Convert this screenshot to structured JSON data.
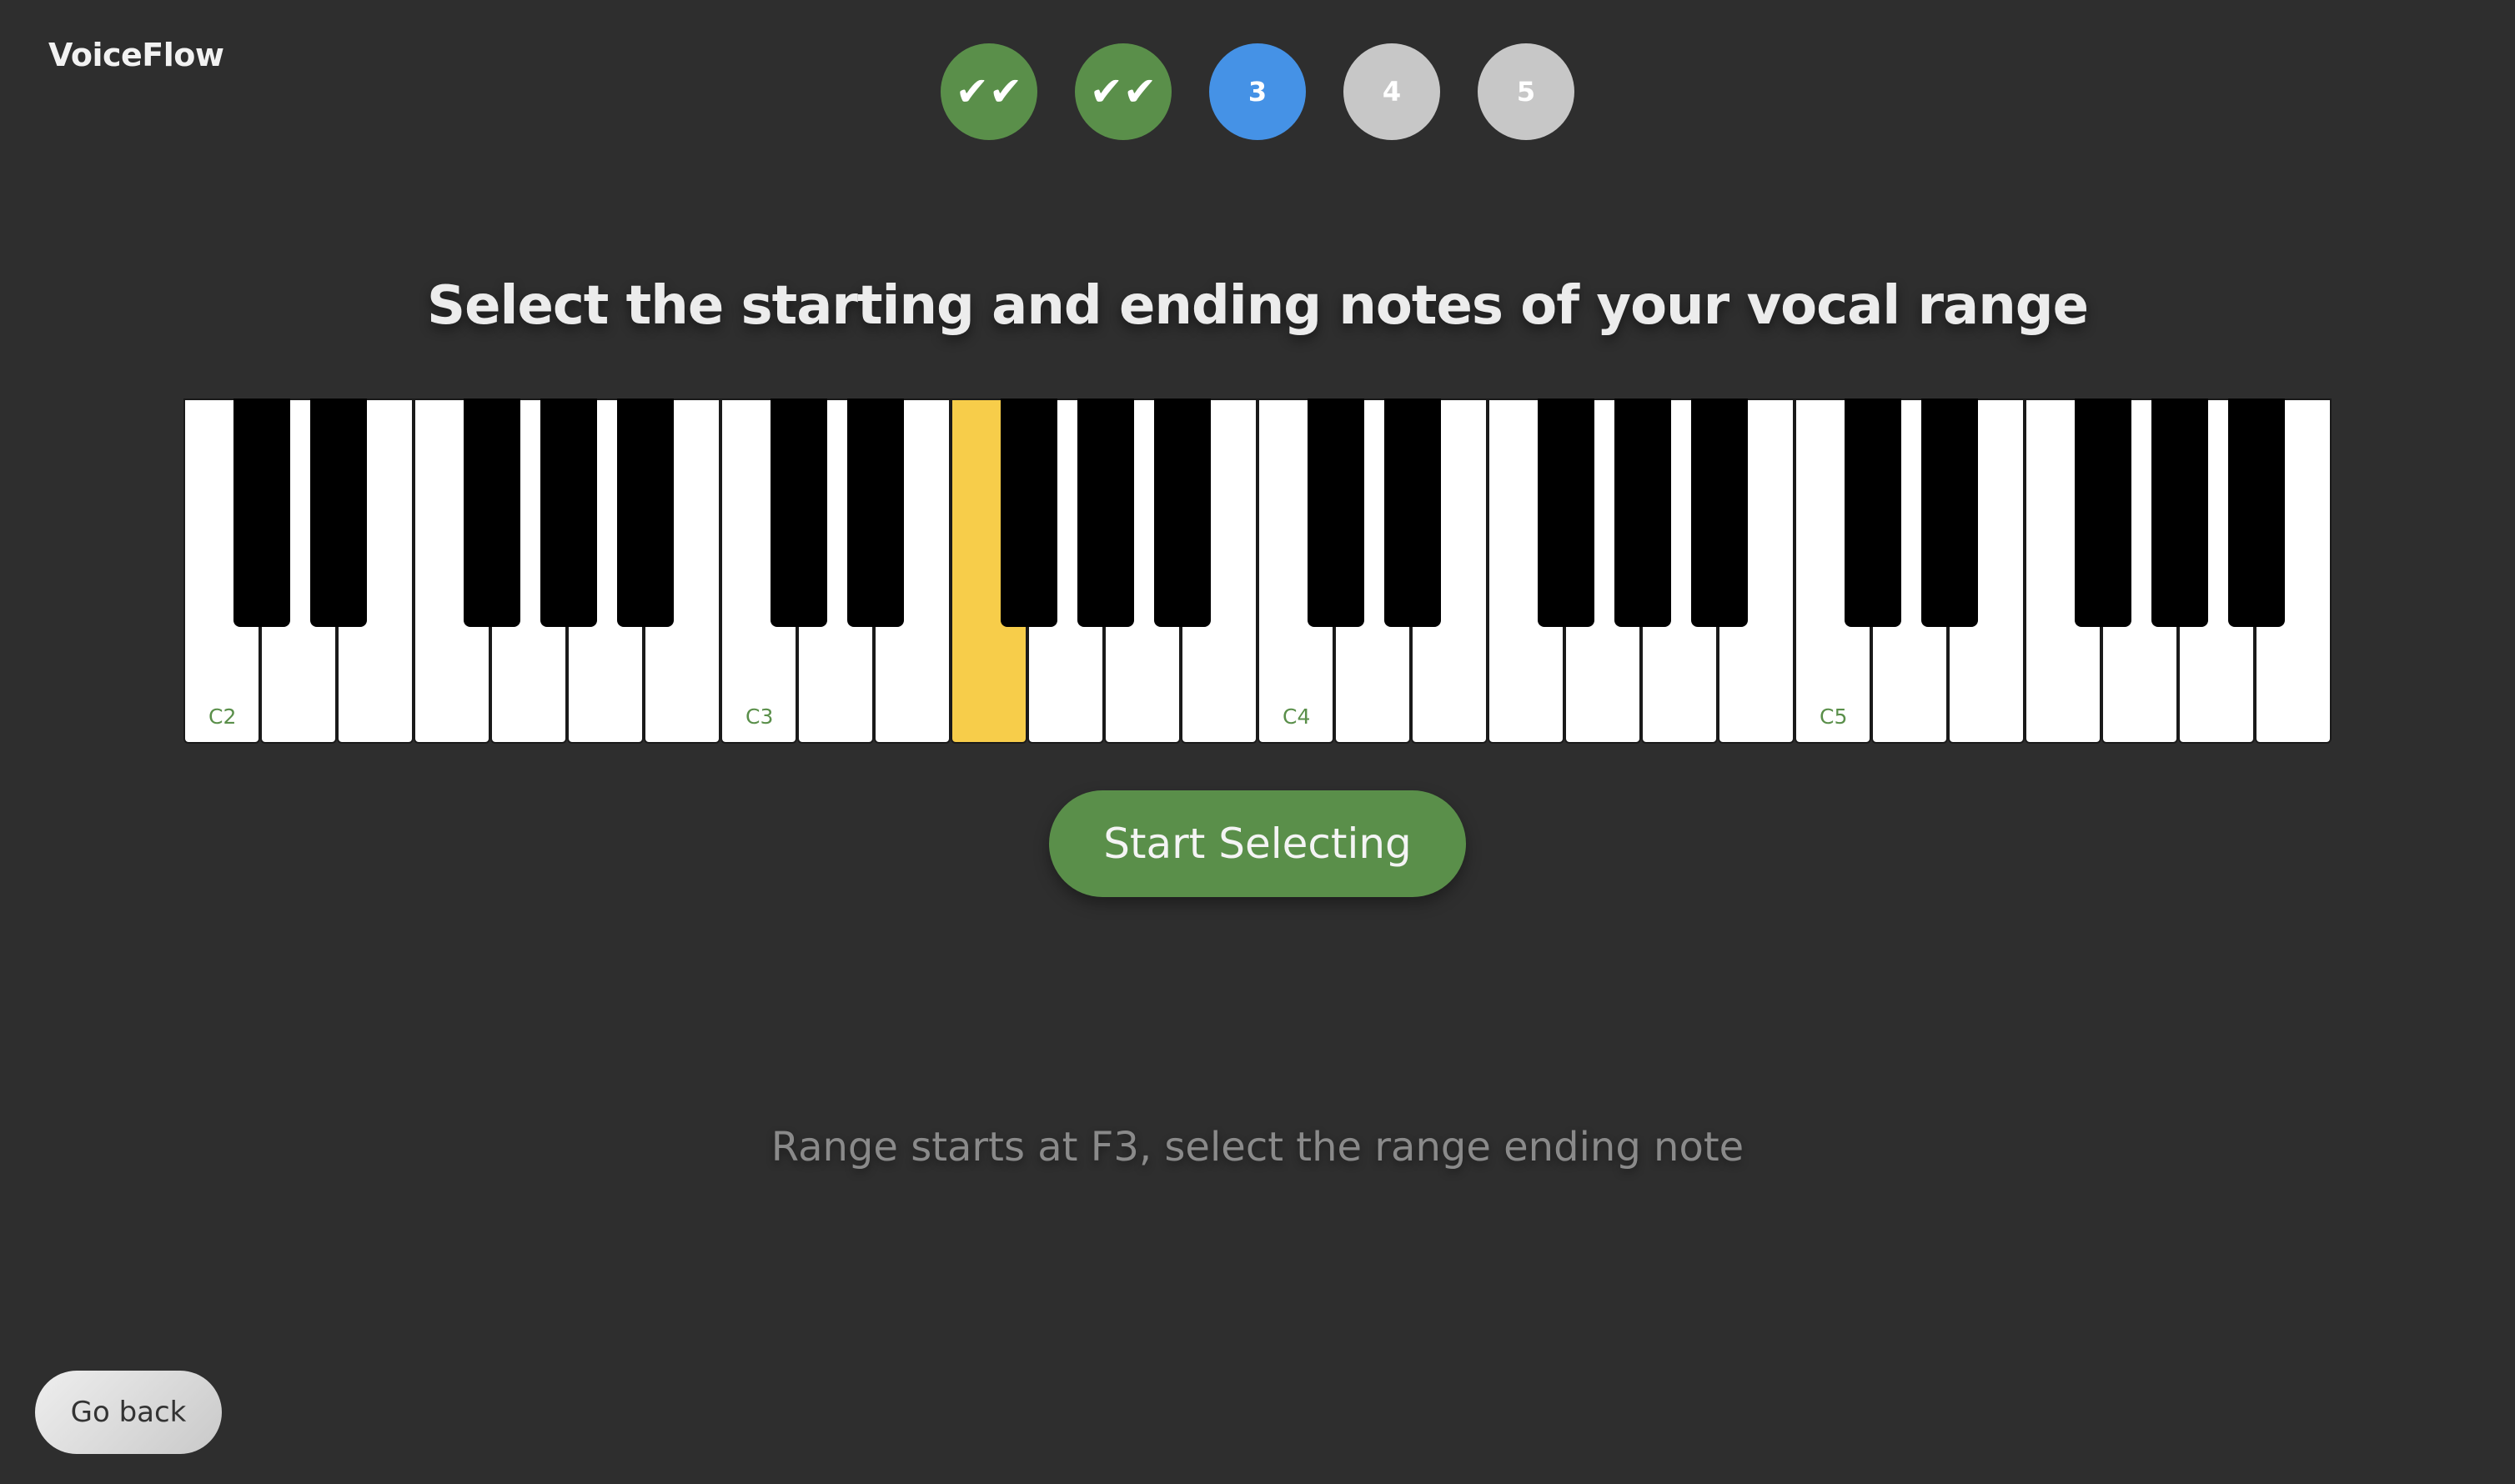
{
  "app": {
    "logo": "VoiceFlow"
  },
  "steps": [
    {
      "label": "✔✔",
      "state": "done"
    },
    {
      "label": "✔✔",
      "state": "done"
    },
    {
      "label": "3",
      "state": "current"
    },
    {
      "label": "4",
      "state": "pending"
    },
    {
      "label": "5",
      "state": "pending"
    }
  ],
  "main": {
    "title": "Select the starting and ending notes of your vocal range",
    "start_button": "Start Selecting",
    "status": "Range starts at F3, select the range ending note",
    "back_button": "Go back"
  },
  "piano": {
    "octave_labels": [
      "C2",
      "C3",
      "C4",
      "C5"
    ],
    "range": "C2–B5",
    "selected_note": "F3"
  },
  "colors": {
    "background": "#2e2e2e",
    "done": "#5a8f4a",
    "current": "#4592e6",
    "pending": "#c7c7c7",
    "selected_key": "#f7cd4a",
    "accent_green": "#5a8f4a"
  }
}
